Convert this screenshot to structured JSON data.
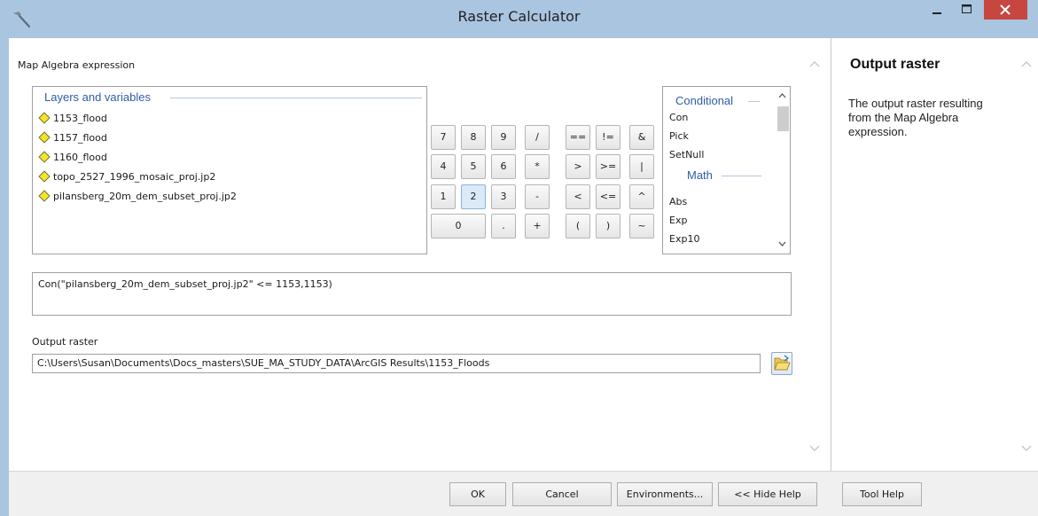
{
  "window": {
    "title": "Raster Calculator"
  },
  "main": {
    "expression_label": "Map Algebra expression",
    "layers": {
      "header": "Layers and variables",
      "items": [
        "1153_flood",
        "1157_flood",
        "1160_flood",
        "topo_2527_1996_mosaic_proj.jp2",
        "pilansberg_20m_dem_subset_proj.jp2"
      ]
    },
    "keypad": {
      "rows": [
        [
          "7",
          "8",
          "9",
          "/",
          "==",
          "!=",
          "&"
        ],
        [
          "4",
          "5",
          "6",
          "*",
          ">",
          ">=",
          "|"
        ],
        [
          "1",
          "2",
          "3",
          "-",
          "<",
          "<=",
          "^"
        ],
        [
          "0",
          ".",
          "+",
          "(",
          ")",
          "~"
        ]
      ],
      "hovered": "2"
    },
    "functions": {
      "group1": "Conditional",
      "items1": [
        "Con",
        "Pick",
        "SetNull"
      ],
      "group2": "Math",
      "items2": [
        "Abs",
        "Exp",
        "Exp10"
      ]
    },
    "expression": "Con(\"pilansberg_20m_dem_subset_proj.jp2\" <= 1153,1153)",
    "output_label": "Output raster",
    "output_value": "C:\\Users\\Susan\\Documents\\Docs_masters\\SUE_MA_STUDY_DATA\\ArcGIS Results\\1153_Floods"
  },
  "help": {
    "title": "Output raster",
    "text": "The output raster resulting from the Map Algebra expression."
  },
  "buttons": {
    "ok": "OK",
    "cancel": "Cancel",
    "environments": "Environments...",
    "hide_help": "<< Hide Help",
    "tool_help": "Tool Help"
  },
  "icons": {
    "app": "hammer-icon",
    "layer": "raster-diamond-icon",
    "browse": "open-folder-icon"
  },
  "colors": {
    "titlebar": "#a9c5e0",
    "close": "#c7463f",
    "group_header": "#2e5ea5",
    "diamond": "#f3e52a"
  }
}
